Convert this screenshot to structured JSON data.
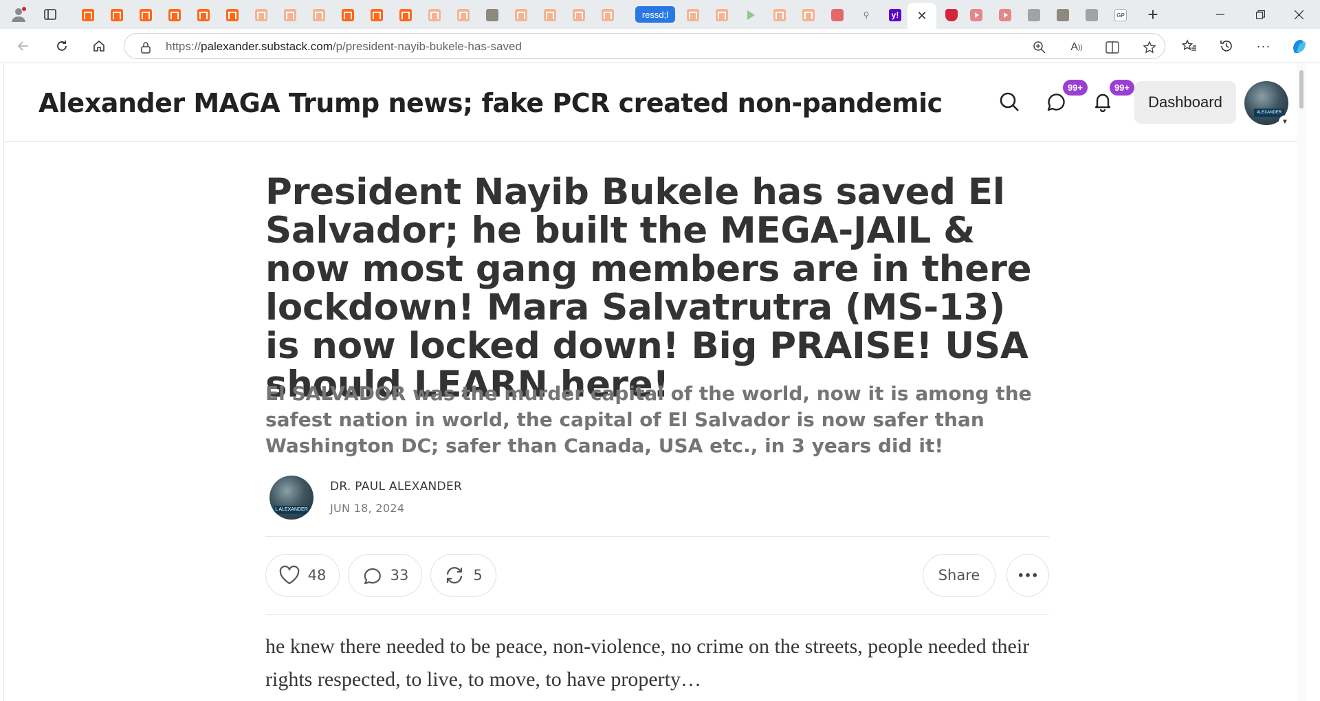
{
  "browser": {
    "active_tab_close": "✕",
    "tab_pill_label": "ressd;l",
    "tab_gp_label": "GP",
    "new_tab": "+",
    "url_prefix": "https://",
    "url_host": "palexander.substack.com",
    "url_path": "/p/president-nayib-bukele-has-saved"
  },
  "site": {
    "title": "Alexander MAGA Trump news; fake PCR created non-pandemic",
    "messages_badge": "99+",
    "notifications_badge": "99+",
    "dashboard_label": "Dashboard",
    "avatar_sign": "ALEXANDER"
  },
  "post": {
    "title": "President Nayib Bukele has saved El Salvador; he built the MEGA-JAIL & now most gang members are in there lockdown! Mara Salvatrutra (MS-13) is now locked down! Big PRAISE! USA should LEARN here!",
    "subtitle": "El SALVADOR was the murder capital of the world, now it is among the safest nation in world, the capital of El Salvador is now safer than Washington DC; safer than Canada, USA etc., in 3 years did it!",
    "author": "DR. PAUL ALEXANDER",
    "date": "JUN 18, 2024",
    "avatar_sign": "L ALEXANDER",
    "likes": "48",
    "comments": "33",
    "restacks": "5",
    "share_label": "Share",
    "more_label": "•••",
    "body": "he knew there needed to be peace, non-violence, no crime on the streets, people needed their rights respected, to live, to move, to have property…"
  },
  "colors": {
    "accent_substack": "#ff6719",
    "badge": "#9a3fd2",
    "title_text": "#333333",
    "subtitle_text": "#757575"
  }
}
